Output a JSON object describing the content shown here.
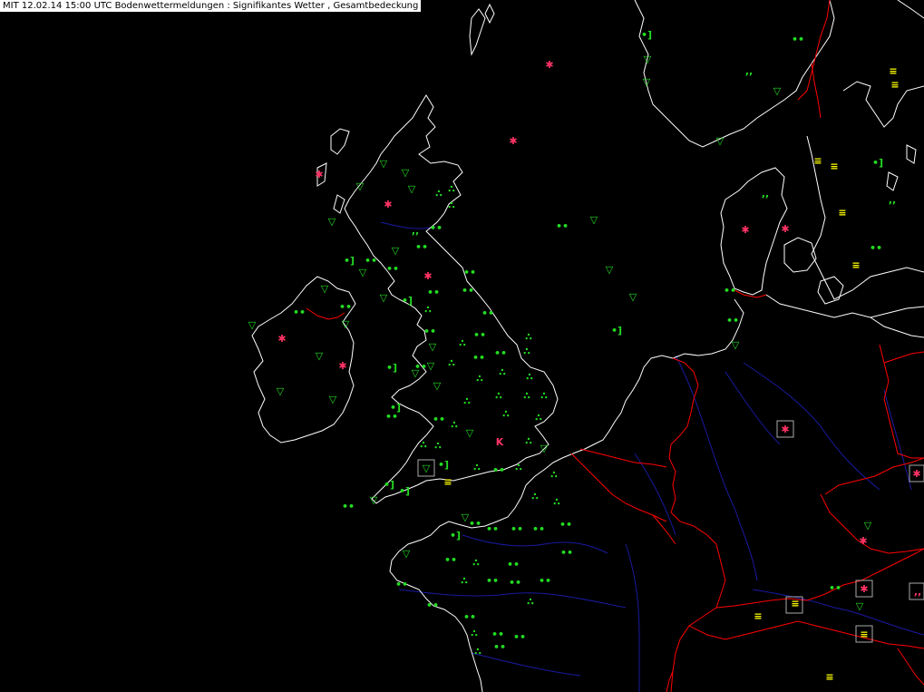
{
  "header": {
    "title": "MIT 12.02.14 15:00 UTC  Bodenwettermeldungen :  Signifikantes Wetter , Gesamtbedeckung"
  },
  "colors": {
    "coastline": "#ffffff",
    "national_border": "#ff0000",
    "river": "#1a1aa0",
    "rain_shower": "#22dd22",
    "snow": "#ff3366",
    "fog_haze": "#ffff00",
    "station_box": "#aaaaaa"
  },
  "legend_icons": {
    "shower": "rain-shower-icon",
    "showers_heavy": "shower-cluster-icon",
    "rain": "rain-dots-icon",
    "drizzle": "drizzle-comma-icon",
    "snow": "snow-star-icon",
    "fog": "fog-lines-icon",
    "thunderstorm": "thunderstorm-icon",
    "precip_ended": "recent-precip-bracket-icon"
  }
}
